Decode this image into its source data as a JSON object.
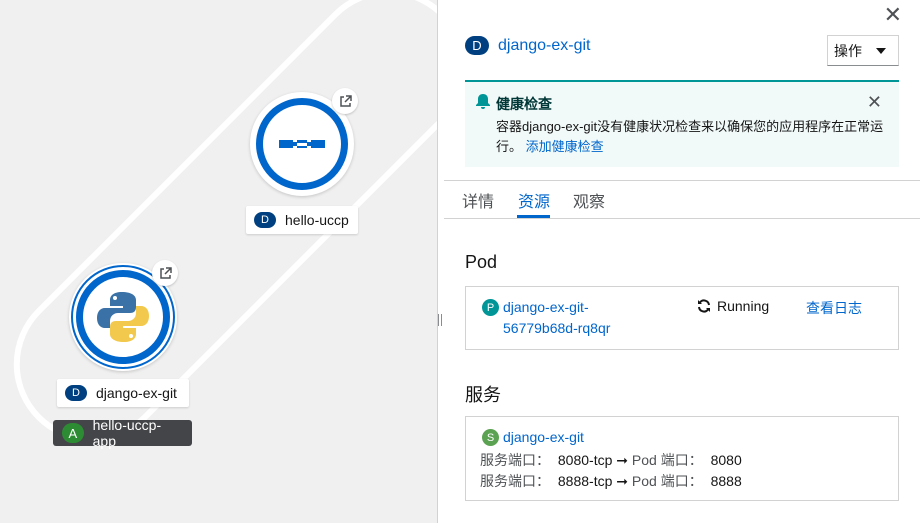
{
  "topology": {
    "app_group_label": "hello-uccp-app",
    "app_badge": "A",
    "nodes": [
      {
        "name": "hello-uccp",
        "badge": "D"
      },
      {
        "name": "django-ex-git",
        "badge": "D"
      }
    ]
  },
  "panel": {
    "close_glyph": "✕",
    "resource": {
      "badge": "D",
      "name": "django-ex-git"
    },
    "actions_label": "操作",
    "alert": {
      "title": "健康检查",
      "body": "容器django-ex-git没有健康状况检查来以确保您的应用程序在正常运行。",
      "link": "添加健康检查",
      "close_glyph": "✕"
    },
    "tabs": [
      "详情",
      "资源",
      "观察"
    ],
    "active_tab": "资源",
    "pod_section": {
      "heading": "Pod",
      "badge": "P",
      "pod_name_line1": "django-ex-git-",
      "pod_name_line2": "56779b68d-rq8qr",
      "status": "Running",
      "logs_link": "查看日志"
    },
    "service_section": {
      "heading": "服务",
      "badge": "S",
      "service_name": "django-ex-git",
      "ports": [
        {
          "label": "服务端口：",
          "port": "8080-tcp",
          "arrow": "➞",
          "pod_label": "Pod 端口：",
          "pod_port": "8080"
        },
        {
          "label": "服务端口：",
          "port": "8888-tcp",
          "arrow": "➞",
          "pod_label": "Pod 端口：",
          "pod_port": "8888"
        }
      ]
    }
  },
  "colors": {
    "link": "#0066cc",
    "node_ring": "#0066cc",
    "deployment_badge": "#004080",
    "app_badge": "#2d8c33",
    "pod_badge": "#009596",
    "service_badge": "#5ba352",
    "alert_bg": "#f2f9f9"
  },
  "icons": {
    "external_link": "external-link-icon",
    "python": "python-logo-icon",
    "uccp": "uccp-logo-icon",
    "bell": "bell-icon",
    "sync": "sync-icon"
  }
}
